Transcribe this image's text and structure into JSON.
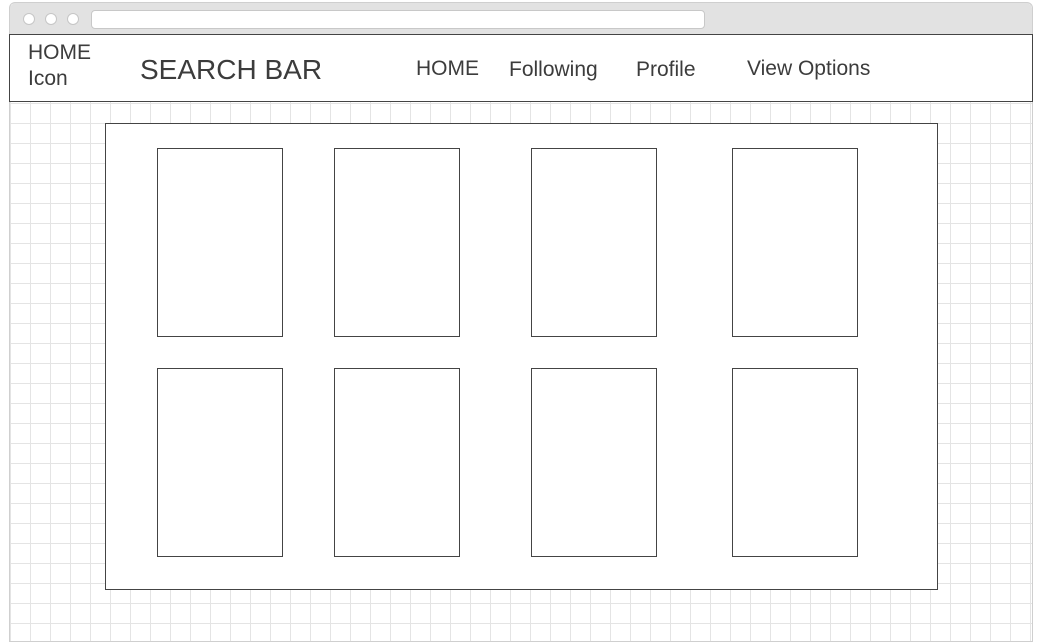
{
  "navbar": {
    "home_icon_label": "HOME Icon",
    "search_label": "SEARCH BAR",
    "links": [
      "HOME",
      "Following",
      "Profile",
      "View Options"
    ]
  },
  "grid": {
    "rows": 2,
    "columns": 4,
    "card_count": 8
  }
}
